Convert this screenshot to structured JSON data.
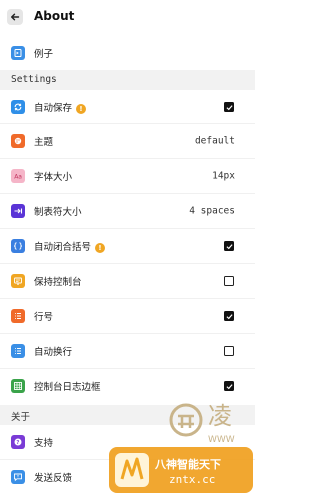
{
  "header": {
    "title": "About"
  },
  "colors": {
    "example": "#3a8fe6",
    "autosave": "#2f8fe8",
    "theme": "#f06a2a",
    "font": "#f5b5c8",
    "tab": "#5a34d6",
    "brackets": "#3a7fe0",
    "console": "#f0a623",
    "lines": "#f06a2a",
    "wrap": "#3a8fe6",
    "log": "#3aa34a",
    "support": "#7a3bd6",
    "feedback": "#3a8fe6",
    "info_badge": "#f0a623"
  },
  "top_item": {
    "label": "例子",
    "icon": "code-file-icon"
  },
  "settings_section": {
    "title": "Settings"
  },
  "settings": [
    {
      "label": "自动保存",
      "control": "checkbox",
      "checked": true,
      "info": true,
      "icon": "sync-icon"
    },
    {
      "label": "主题",
      "control": "value",
      "value": "default",
      "icon": "palette-icon"
    },
    {
      "label": "字体大小",
      "control": "value",
      "value": "14px",
      "icon": "font-size-icon"
    },
    {
      "label": "制表符大小",
      "control": "value",
      "value": "4 spaces",
      "icon": "tab-icon"
    },
    {
      "label": "自动闭合括号",
      "control": "checkbox",
      "checked": true,
      "info": true,
      "icon": "brackets-icon"
    },
    {
      "label": "保持控制台",
      "control": "checkbox",
      "checked": false,
      "icon": "console-icon"
    },
    {
      "label": "行号",
      "control": "checkbox",
      "checked": true,
      "icon": "line-numbers-icon"
    },
    {
      "label": "自动换行",
      "control": "checkbox",
      "checked": false,
      "icon": "wrap-icon"
    },
    {
      "label": "控制台日志边框",
      "control": "checkbox",
      "checked": true,
      "icon": "log-border-icon"
    }
  ],
  "about_section": {
    "title": "关于"
  },
  "about": [
    {
      "label": "支持",
      "icon": "help-icon"
    },
    {
      "label": "发送反馈",
      "icon": "feedback-icon"
    }
  ],
  "watermark": {
    "seal_text": "凌",
    "seal_sub": "WWW",
    "brand": "八神智能天下",
    "domain": "zntx.cc"
  }
}
